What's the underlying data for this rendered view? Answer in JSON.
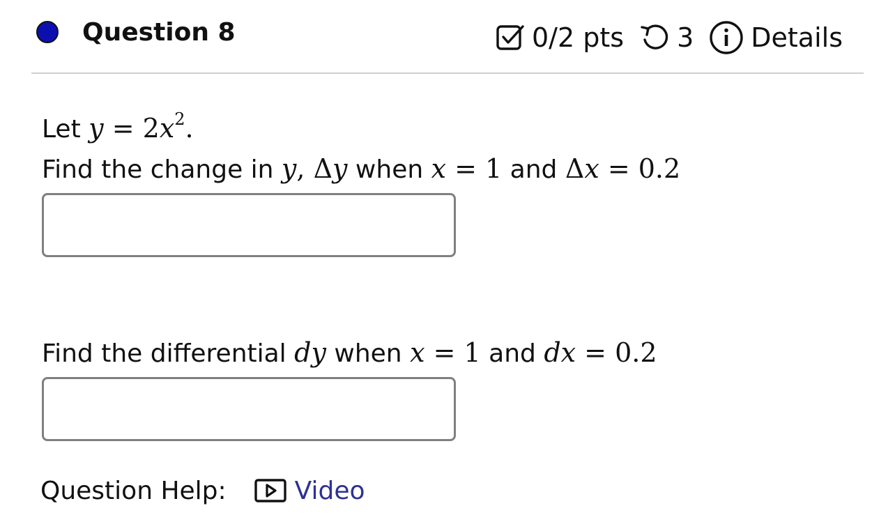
{
  "question": {
    "status_color": "#0b0fb0",
    "title": "Question 8",
    "score": "0/2 pts",
    "attempts": "3",
    "details_label": "Details"
  },
  "problem": {
    "intro_label": "Let",
    "function_lhs": "y",
    "function_eq": "=",
    "function_coef": "2",
    "function_var": "x",
    "function_exp": "2",
    "function_end": ".",
    "part1": {
      "text_a": "Find the change in ",
      "var_y": "y",
      "comma": ", ",
      "delta_y": "Δ",
      "delta_y_var": "y",
      "text_when": " when ",
      "x_var": "x",
      "eq1": " = ",
      "x_val": "1",
      "text_and": " and ",
      "delta_x": "Δ",
      "delta_x_var": "x",
      "eq2": " = ",
      "dx_val": "0.2",
      "input_value": ""
    },
    "part2": {
      "text_a": "Find the differential ",
      "dy_d": "d",
      "dy_var": "y",
      "text_when": " when ",
      "x_var": "x",
      "eq1": " = ",
      "x_val": "1",
      "text_and": " and ",
      "dx_d": "d",
      "dx_var": "x",
      "eq2": " = ",
      "dx_val": "0.2",
      "input_value": ""
    }
  },
  "help": {
    "label": "Question Help:",
    "video_label": "Video",
    "link_color": "#2e3192"
  },
  "icons": {
    "score": "checkbox-check-icon",
    "attempts": "retry-icon",
    "details": "info-circle-icon",
    "video": "play-box-icon"
  }
}
